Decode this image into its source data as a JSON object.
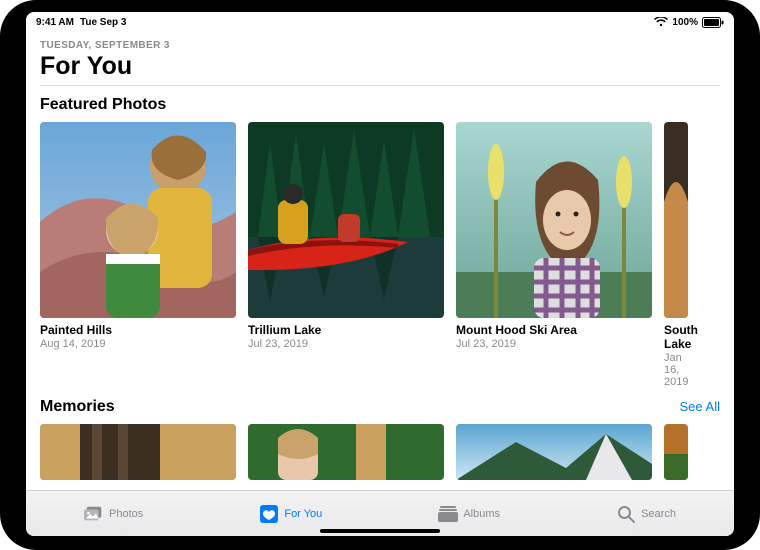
{
  "status": {
    "time": "9:41 AM",
    "date": "Tue Sep 3",
    "battery_text": "100%"
  },
  "header": {
    "date_line": "TUESDAY, SEPTEMBER 3",
    "title": "For You"
  },
  "featured": {
    "section_title": "Featured Photos",
    "cards": [
      {
        "title": "Painted Hills",
        "sub": "Aug 14, 2019"
      },
      {
        "title": "Trillium Lake",
        "sub": "Jul 23, 2019"
      },
      {
        "title": "Mount Hood Ski Area",
        "sub": "Jul 23, 2019"
      },
      {
        "title": "South Lake",
        "sub": "Jan 16, 2019"
      }
    ]
  },
  "memories": {
    "section_title": "Memories",
    "see_all_label": "See All"
  },
  "tabs": {
    "photos": "Photos",
    "for_you": "For You",
    "albums": "Albums",
    "search": "Search",
    "active": "for_you"
  }
}
